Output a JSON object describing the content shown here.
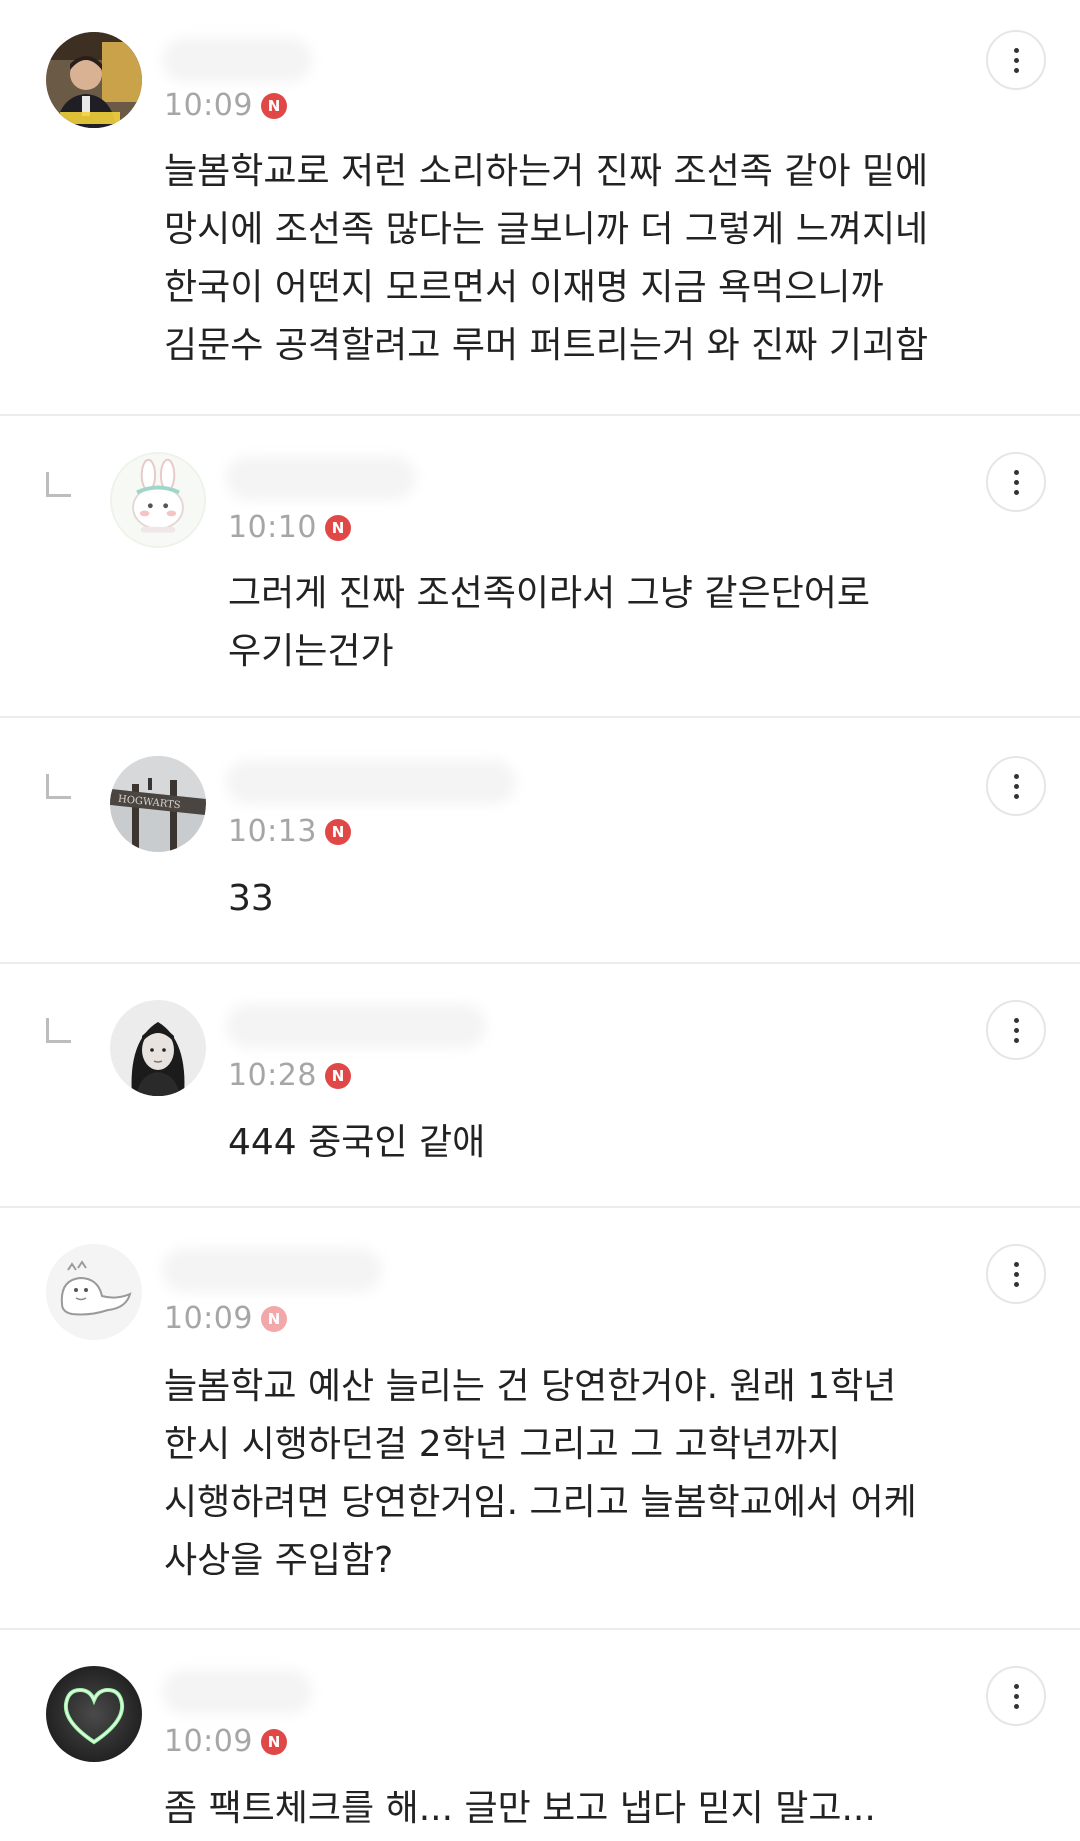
{
  "comments": [
    {
      "time": "10:09",
      "badge": "N",
      "avatar": "man-presenter-avatar",
      "text": "늘봄학교로 저런 소리하는거 진짜 조선족 같아 밑에\n망시에 조선족 많다는 글보니까 더 그렇게 느껴지네\n한국이 어떤지 모르면서 이재명 지금 욕먹으니까\n김문수 공격할려고 루머 퍼트리는거 와 진짜 기괴함"
    },
    {
      "time": "10:10",
      "badge": "N",
      "avatar": "bunny-avatar",
      "text": "그러게 진짜 조선족이라서 그냥 같은단어로\n우기는건가"
    },
    {
      "time": "10:13",
      "badge": "N",
      "avatar": "hogwarts-sign-avatar",
      "avatar_label": "HOGWARTS",
      "text": "33"
    },
    {
      "time": "10:28",
      "badge": "N",
      "avatar": "woman-portrait-avatar",
      "text": "444 중국인 같애"
    },
    {
      "time": "10:09",
      "badge": "N",
      "avatar": "dinosaur-sketch-avatar",
      "text": "늘봄학교 예산 늘리는 건 당연한거야. 원래 1학년\n한시 시행하던걸 2학년 그리고 그 고학년까지\n시행하려면 당연한거임. 그리고 늘봄학교에서 어케\n사상을 주입함?"
    },
    {
      "time": "10:09",
      "badge": "N",
      "avatar": "neon-heart-avatar",
      "text": "좀 팩트체크를 해... 글만 보고 냅다 믿지 말고..."
    }
  ],
  "colors": {
    "badge": "#e04848",
    "time": "#a6a6a6",
    "divider": "#ececec",
    "heart_glow": "#9cf5a8"
  }
}
